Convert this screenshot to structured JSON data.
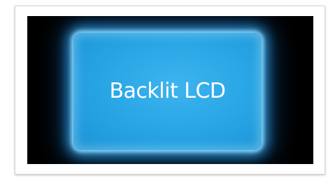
{
  "slide": {
    "text": "Backlit LCD"
  },
  "colors": {
    "background": "#000000",
    "panel": "#2aa7e6",
    "glow": "#5fc6f5",
    "text": "#ffffff"
  }
}
